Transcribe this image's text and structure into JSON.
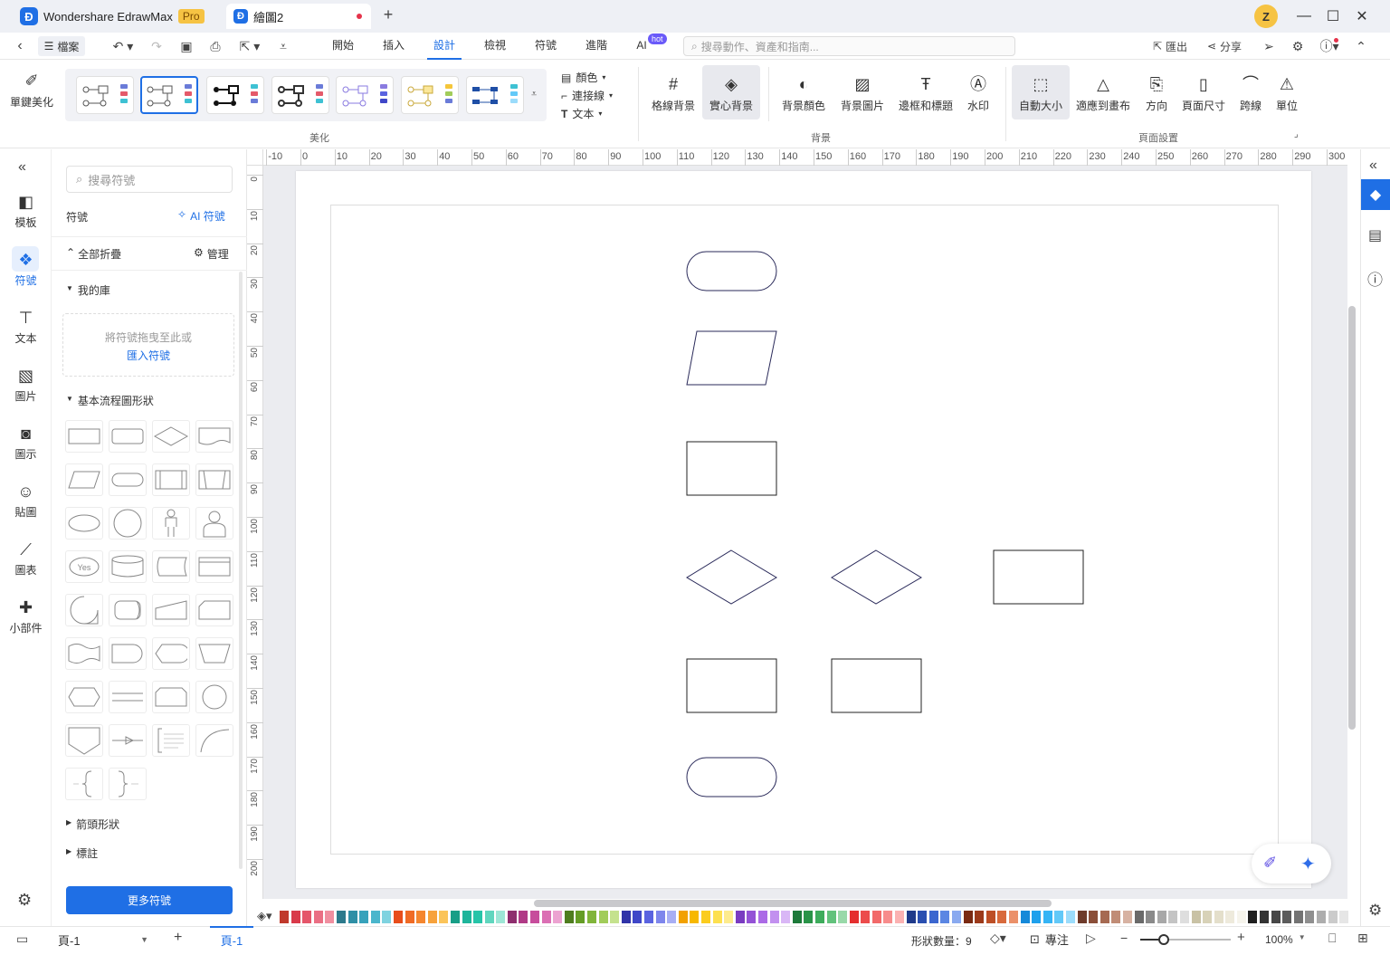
{
  "titlebar": {
    "app_name": "Wondershare EdrawMax",
    "pro_badge": "Pro",
    "doc_tab": "繪圖2",
    "add_tab": "+",
    "avatar_letter": "Z"
  },
  "menubar": {
    "file_label": "檔案",
    "tabs": [
      "開始",
      "插入",
      "設計",
      "檢視",
      "符號",
      "進階",
      "AI"
    ],
    "active_tab": "設計",
    "ai_badge": "hot",
    "search_placeholder": "搜尋動作、資產和指南...",
    "export_label": "匯出",
    "share_label": "分享"
  },
  "ribbon": {
    "beautify_label": "單鍵美化",
    "group_beautify": "美化",
    "color_label": "顏色",
    "connector_label": "連接線",
    "text_label": "文本",
    "grid_bg_label": "格線背景",
    "solid_bg_label": "實心背景",
    "bg_color_label": "背景顏色",
    "bg_image_label": "背景圖片",
    "border_title_label": "邊框和標題",
    "watermark_label": "水印",
    "group_background": "背景",
    "auto_size_label": "自動大小",
    "fit_canvas_label": "適應到畫布",
    "orientation_label": "方向",
    "page_size_label": "頁面尺寸",
    "jump_line_label": "跨線",
    "unit_label": "單位",
    "group_page_setup": "頁面設置"
  },
  "leftnav": {
    "items": [
      "模板",
      "符號",
      "文本",
      "圖片",
      "圖示",
      "貼圖",
      "圖表",
      "小部件"
    ],
    "active": "符號"
  },
  "library": {
    "search_placeholder": "搜尋符號",
    "title": "符號",
    "ai_symbols": "AI 符號",
    "collapse_all": "全部折疊",
    "manage": "管理",
    "my_library": "我的庫",
    "drop_hint": "將符號拖曳至此或",
    "import_link": "匯入符號",
    "basic_flowchart": "基本流程圖形狀",
    "arrow_shapes": "箭頭形狀",
    "callouts": "標註",
    "more_symbols": "更多符號",
    "yes_shape_text": "Yes"
  },
  "ruler": {
    "h_ticks": [
      "-10",
      "0",
      "10",
      "20",
      "30",
      "40",
      "50",
      "60",
      "70",
      "80",
      "90",
      "100",
      "110",
      "120",
      "130",
      "140",
      "150",
      "160",
      "170",
      "180",
      "190",
      "200",
      "210",
      "220",
      "230",
      "240",
      "250",
      "260",
      "270",
      "280",
      "290",
      "300"
    ],
    "v_ticks": [
      "0",
      "10",
      "20",
      "30",
      "40",
      "50",
      "60",
      "70",
      "80",
      "90",
      "100",
      "110",
      "120",
      "130",
      "140",
      "150",
      "160",
      "170",
      "180",
      "190",
      "200"
    ]
  },
  "palette": {
    "colors": [
      "#c0392b",
      "#d93a4a",
      "#e5566a",
      "#ea6f84",
      "#f08fa0",
      "#2d7a8c",
      "#2f8fa6",
      "#37a2bb",
      "#4bb6cc",
      "#7fd3e0",
      "#e84e1b",
      "#f06b25",
      "#f5862f",
      "#f7a23c",
      "#fbc45a",
      "#179e87",
      "#1fb59b",
      "#26c4a8",
      "#60d6be",
      "#9de6d6",
      "#8e2e6e",
      "#b03a86",
      "#c74d9c",
      "#db6fb4",
      "#eca3d1",
      "#4f7d1f",
      "#659d26",
      "#81b53a",
      "#a1cc5a",
      "#c5e28e",
      "#3033a8",
      "#3f47c8",
      "#5a63e0",
      "#7e86ec",
      "#a8aef4",
      "#f2a100",
      "#f7b800",
      "#fbcc1e",
      "#fde04f",
      "#fdeb8d",
      "#7a3bc1",
      "#9452d6",
      "#ab6be6",
      "#c290ef",
      "#d9b7f6",
      "#1d7a3a",
      "#2a9448",
      "#3eac5c",
      "#62c27c",
      "#99d9a9",
      "#e52f2f",
      "#ec4c4c",
      "#f26a6a",
      "#f78c8c",
      "#fbb2b2",
      "#1f3a8a",
      "#2a4fb0",
      "#3b66cf",
      "#5b86e3",
      "#8aaaf0",
      "#7a2a12",
      "#9c3a1a",
      "#bd4f26",
      "#d86a3c",
      "#eb9069",
      "#1589d9",
      "#1ea0ec",
      "#35b4f5",
      "#62c9f8",
      "#9bdcfb",
      "#6e3b2a",
      "#8a4e38",
      "#a66a52",
      "#c08c76",
      "#d7b2a2",
      "#6a6a6a",
      "#8a8a8a",
      "#a8a8a8",
      "#c4c4c4",
      "#dedede",
      "#c9c2a5",
      "#d8d2b8",
      "#e4dfcb",
      "#eeeadc",
      "#f6f4ec",
      "#1f1f1f",
      "#333333",
      "#474747",
      "#5c5c5c",
      "#737373",
      "#8f8f8f",
      "#adadad",
      "#cbcbcb",
      "#e6e6e6"
    ]
  },
  "statusbar": {
    "page_select": "頁-1",
    "add_page": "+",
    "active_page": "頁-1",
    "shape_count": "形狀數量：9",
    "focus": "專注",
    "zoom": "100%"
  }
}
